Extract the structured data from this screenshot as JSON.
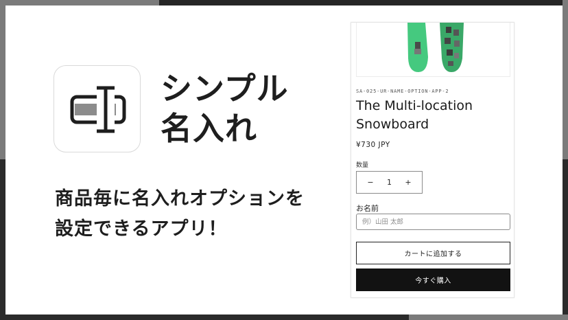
{
  "app": {
    "title_line1": "シンプル",
    "title_line2": "名入れ",
    "icon": "name-engraving-icon",
    "tagline_line1": "商品毎に名入れオプションを",
    "tagline_line2": "設定できるアプリ！"
  },
  "product": {
    "image": "snowboard-product-image",
    "sku": "SA-025-UR-NAME-OPTION-APP-2",
    "title_line1": "The Multi-location",
    "title_line2": "Snowboard",
    "price": "¥730 JPY",
    "quantity_label": "数量",
    "quantity_value": "1",
    "decrement_symbol": "−",
    "increment_symbol": "+",
    "name_label": "お名前",
    "name_placeholder": "例）山田 太郎",
    "name_value": "",
    "add_to_cart_label": "カートに追加する",
    "buy_now_label": "今すぐ購入"
  },
  "colors": {
    "background_dark": "#2b2b2b",
    "frame_gray": "#7b7b7b",
    "button_dark": "#121212",
    "snowboard_green": "#3ec27a"
  }
}
